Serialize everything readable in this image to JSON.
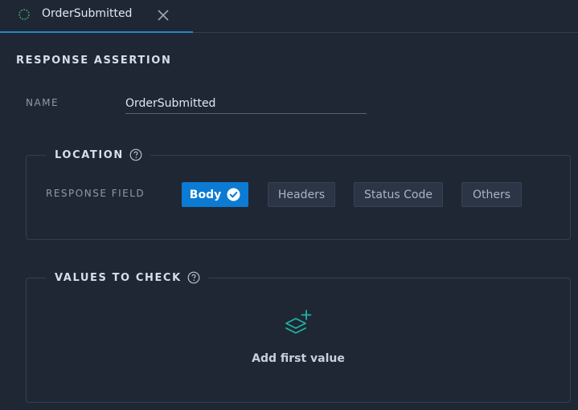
{
  "tab": {
    "title": "OrderSubmitted",
    "status_icon": "status-ring-icon",
    "close_icon": "close-icon"
  },
  "section": {
    "title": "RESPONSE ASSERTION"
  },
  "name_field": {
    "label": "NAME",
    "value": "OrderSubmitted"
  },
  "location": {
    "legend": "LOCATION",
    "field_label": "RESPONSE FIELD",
    "options": [
      {
        "label": "Body",
        "selected": true
      },
      {
        "label": "Headers",
        "selected": false
      },
      {
        "label": "Status Code",
        "selected": false
      },
      {
        "label": "Others",
        "selected": false
      }
    ]
  },
  "values": {
    "legend": "VALUES TO CHECK",
    "add_label": "Add first value",
    "add_icon": "add-layers-icon"
  },
  "colors": {
    "background": "#1f2735",
    "accent": "#0b7bd4",
    "teal": "#1fb5a3",
    "tab_underline": "#1e88c9"
  }
}
